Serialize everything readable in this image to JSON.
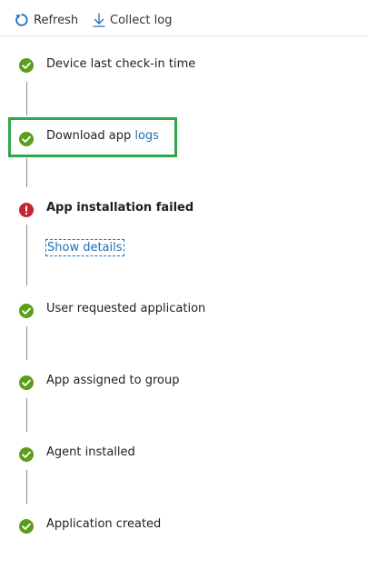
{
  "toolbar": {
    "refresh_label": "Refresh",
    "collect_log_label": "Collect log"
  },
  "steps": [
    {
      "label": "Device last check-in time",
      "status": "success"
    },
    {
      "label_prefix": "Download app ",
      "link": "logs",
      "status": "success",
      "highlighted": true
    },
    {
      "label": "App installation failed",
      "status": "error",
      "action": "Show details"
    },
    {
      "label": "User requested application",
      "status": "success"
    },
    {
      "label": "App assigned to group",
      "status": "success"
    },
    {
      "label": "Agent installed",
      "status": "success"
    },
    {
      "label": "Application created",
      "status": "success"
    }
  ],
  "colors": {
    "success": "#5c9e1b",
    "error": "#c4262e",
    "link": "#1f6fb8",
    "highlight_border": "#2ea64a",
    "refresh_icon": "#1f6fb8"
  },
  "icons": {
    "refresh": "refresh-icon",
    "collect_log": "download-arrow-icon",
    "success": "check-circle-icon",
    "error": "exclamation-circle-icon"
  }
}
